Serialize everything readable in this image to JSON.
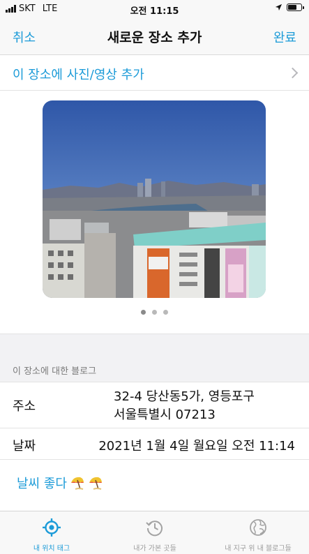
{
  "status_bar": {
    "carrier": "SKT",
    "network": "LTE",
    "time": "오전 11:15",
    "battery_level": 0.6
  },
  "nav": {
    "cancel_label": "취소",
    "title": "새로운 장소 추가",
    "done_label": "완료"
  },
  "add_media": {
    "label": "이 장소에 사진/영상 추가"
  },
  "photo_carousel": {
    "page_count": 3,
    "current_page": 1
  },
  "section": {
    "header": "이 장소에 대한 블로그"
  },
  "address": {
    "label": "주소",
    "line1": "32-4 당산동5가, 영등포구",
    "line2": "서울특별시 07213"
  },
  "date": {
    "label": "날짜",
    "value": "2021년 1월 4일 월요일 오전 11:14"
  },
  "blog": {
    "text": "날씨 좋다"
  },
  "tabs": [
    {
      "label": "내 위치 태그",
      "icon": "location-target-icon",
      "active": true
    },
    {
      "label": "내가 가본 곳들",
      "icon": "history-clock-icon",
      "active": false
    },
    {
      "label": "내 지구 위 내 블로그들",
      "icon": "globe-icon",
      "active": false
    }
  ],
  "colors": {
    "accent": "#1c9bd8",
    "separator": "#e3e3e3",
    "section_bg": "#f2f2f4"
  }
}
